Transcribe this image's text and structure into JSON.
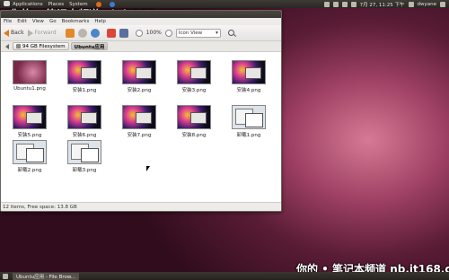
{
  "top_panel": {
    "menus": [
      "Applications",
      "Places",
      "System"
    ],
    "clock": "7月 27, 11:25 下午",
    "user": "dwyane"
  },
  "watermarks": {
    "top": "你的 • 笔记本频道  nb.it168.com",
    "bottom": "你的 • 笔记本频道  nb.it168.com"
  },
  "window": {
    "menubar": [
      "File",
      "Edit",
      "View",
      "Go",
      "Bookmarks",
      "Help"
    ],
    "toolbar": {
      "back": "Back",
      "forward": "Forward",
      "zoom": "100%",
      "view_mode": "Icon View"
    },
    "pathbar": [
      "94 GB Filesystem",
      "Ubuntu应用"
    ],
    "files": [
      {
        "name": "Ubuntu1.png",
        "style": "pink"
      },
      {
        "name": "安装1.png",
        "style": "dark"
      },
      {
        "name": "安装2.png",
        "style": "dark"
      },
      {
        "name": "安装3.png",
        "style": "dark"
      },
      {
        "name": "安装4.png",
        "style": "dark"
      },
      {
        "name": "安装5.png",
        "style": "dark"
      },
      {
        "name": "安装6.png",
        "style": "dark"
      },
      {
        "name": "安装7.png",
        "style": "dark"
      },
      {
        "name": "安装8.png",
        "style": "dark"
      },
      {
        "name": "卸载1.png",
        "style": "light"
      },
      {
        "name": "卸载2.png",
        "style": "light"
      },
      {
        "name": "卸载3.png",
        "style": "light"
      }
    ],
    "status": "12 items, Free space: 13.8 GB"
  },
  "taskbar": {
    "task": "Ubuntu应用 - File Brow..."
  },
  "colors": {
    "accent_orange": "#e07a1f",
    "wallpaper": "#9c3f62"
  }
}
